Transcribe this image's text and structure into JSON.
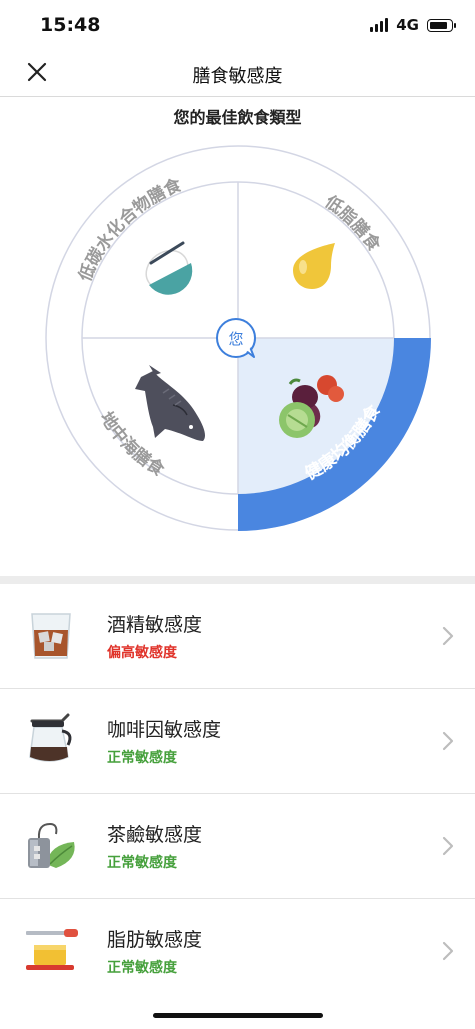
{
  "status_bar": {
    "time": "15:48",
    "network": "4G"
  },
  "nav": {
    "title": "膳食敏感度",
    "close_icon": "close-icon"
  },
  "diet_wheel": {
    "title": "您的最佳飲食類型",
    "you_label": "您",
    "selected": "健康均衡膳食",
    "accent_color": "#4a86e0",
    "selected_fill": "#e3edfa",
    "quadrants": [
      {
        "id": "low-carb",
        "label": "低碳水化合物膳食",
        "icon": "rice-bowl-icon"
      },
      {
        "id": "low-fat",
        "label": "低脂膳食",
        "icon": "oil-drop-icon"
      },
      {
        "id": "mediterranean",
        "label": "地中海膳食",
        "icon": "fish-icon"
      },
      {
        "id": "balanced",
        "label": "健康均衡膳食",
        "icon": "vegetables-icon"
      }
    ]
  },
  "sensitivities": [
    {
      "title": "酒精敏感度",
      "status": "偏高敏感度",
      "status_color": "#e0332a",
      "icon": "whiskey-glass-icon"
    },
    {
      "title": "咖啡因敏感度",
      "status": "正常敏感度",
      "status_color": "#46a03c",
      "icon": "coffee-pot-icon"
    },
    {
      "title": "茶鹼敏感度",
      "status": "正常敏感度",
      "status_color": "#46a03c",
      "icon": "tea-icon"
    },
    {
      "title": "脂肪敏感度",
      "status": "正常敏感度",
      "status_color": "#46a03c",
      "icon": "butter-icon"
    }
  ]
}
